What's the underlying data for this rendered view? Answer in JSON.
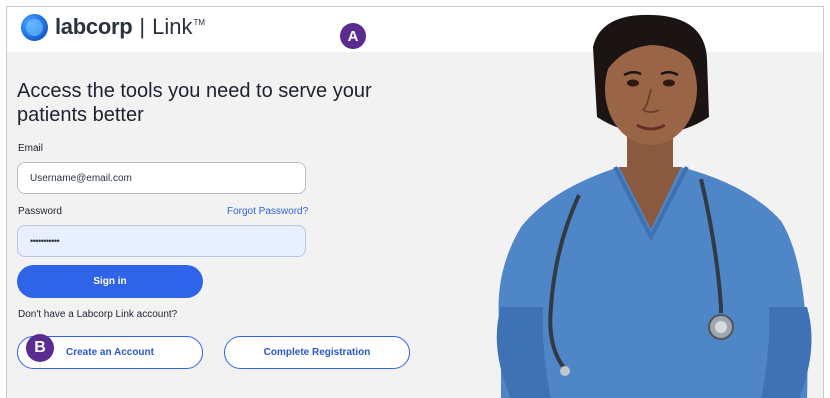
{
  "brand": {
    "name": "labcorp",
    "product": "Link",
    "trademark": "TM"
  },
  "markers": {
    "a": "A",
    "b": "B"
  },
  "login": {
    "headline": "Access the tools you need to serve your patients better",
    "email_label": "Email",
    "email_value": "Username@email.com",
    "password_label": "Password",
    "forgot_label": "Forgot Password?",
    "password_value": "•••••••••••",
    "signin_label": "Sign in",
    "no_account_text": "Don't have a Labcorp Link account?",
    "create_account_label": "Create an Account",
    "complete_registration_label": "Complete Registration"
  },
  "colors": {
    "accent": "#2f63e8",
    "marker": "#5b2c8f",
    "scrubs": "#4f86c8"
  },
  "icons": [
    "labcorp-logo-icon",
    "stethoscope-icon"
  ]
}
